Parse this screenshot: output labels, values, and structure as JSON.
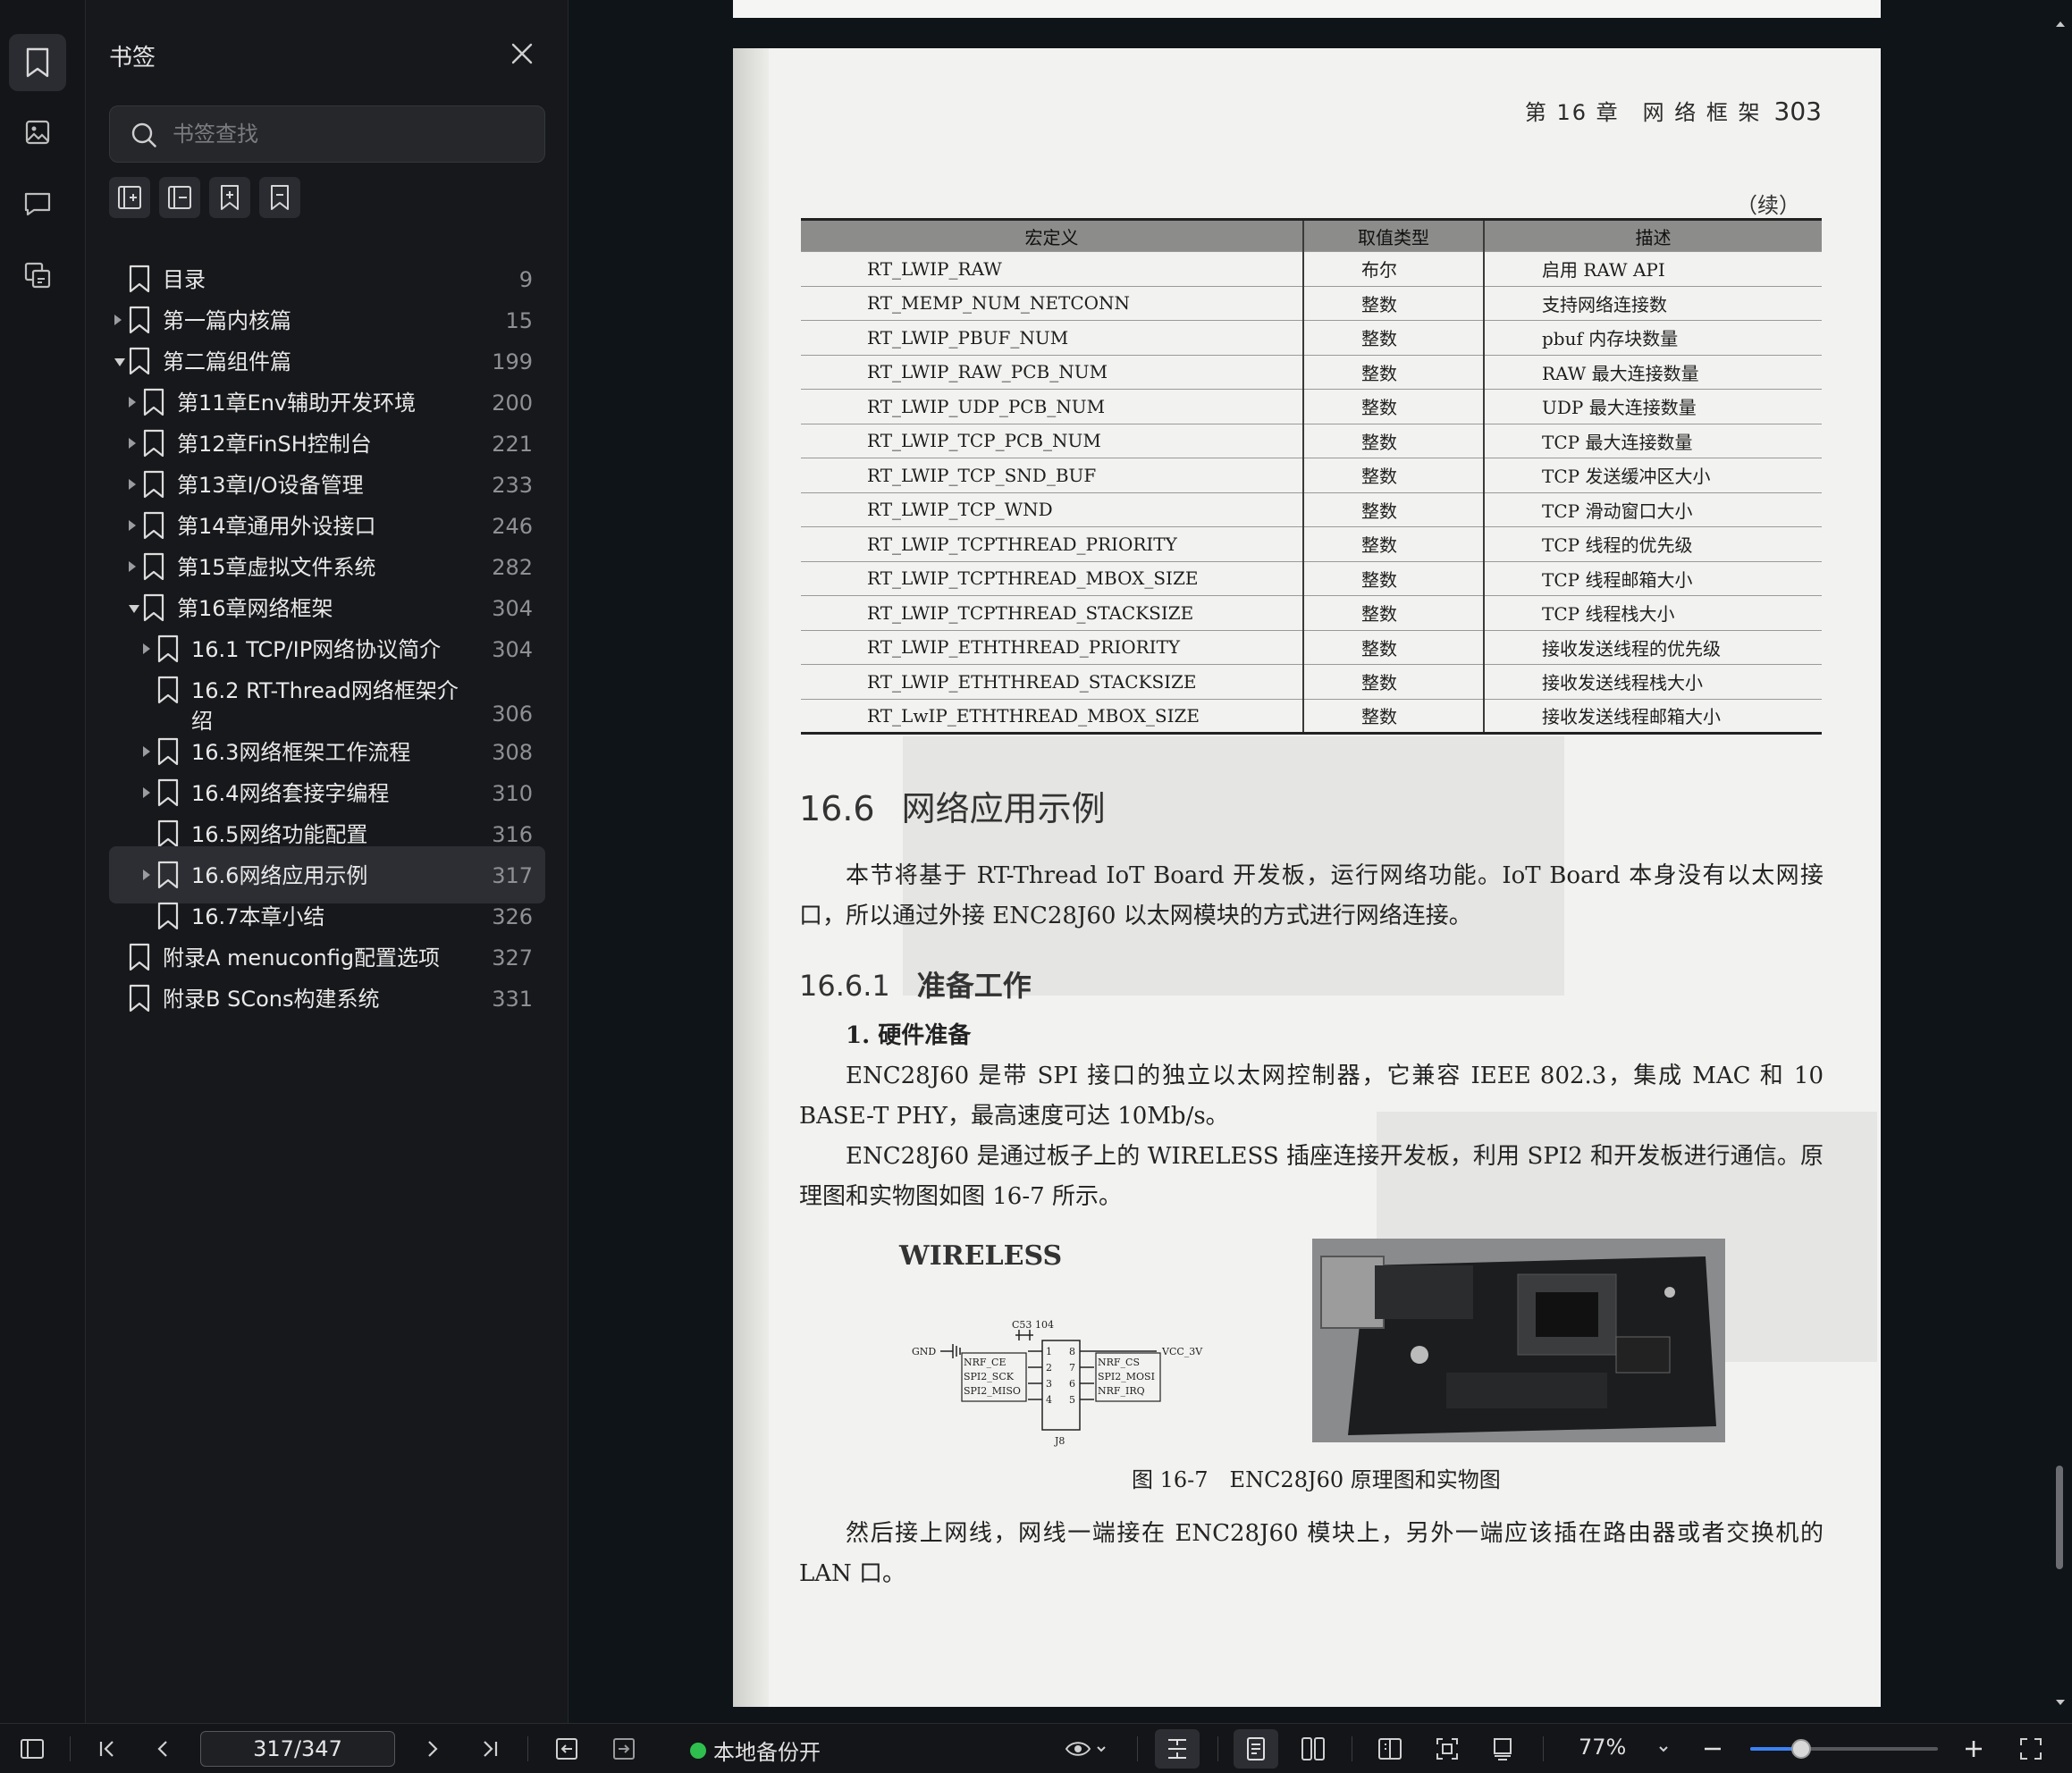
{
  "sidebar": {
    "title": "书签",
    "search_placeholder": "书签查找",
    "items": [
      {
        "label": "目录",
        "page": "9",
        "level": 0,
        "arrow": "none"
      },
      {
        "label": "第一篇内核篇",
        "page": "15",
        "level": 0,
        "arrow": "right"
      },
      {
        "label": "第二篇组件篇",
        "page": "199",
        "level": 0,
        "arrow": "down"
      },
      {
        "label": "第11章Env辅助开发环境",
        "page": "200",
        "level": 1,
        "arrow": "right"
      },
      {
        "label": "第12章FinSH控制台",
        "page": "221",
        "level": 1,
        "arrow": "right"
      },
      {
        "label": "第13章I/O设备管理",
        "page": "233",
        "level": 1,
        "arrow": "right"
      },
      {
        "label": "第14章通用外设接口",
        "page": "246",
        "level": 1,
        "arrow": "right"
      },
      {
        "label": "第15章虚拟文件系统",
        "page": "282",
        "level": 1,
        "arrow": "right"
      },
      {
        "label": "第16章网络框架",
        "page": "304",
        "level": 1,
        "arrow": "down"
      },
      {
        "label": "16.1 TCP/IP网络协议简介",
        "page": "304",
        "level": 2,
        "arrow": "right"
      },
      {
        "label": "16.2 RT-Thread网络框架介",
        "label2": "绍",
        "page": "306",
        "level": 2,
        "arrow": "none"
      },
      {
        "label": "16.3网络框架工作流程",
        "page": "308",
        "level": 2,
        "arrow": "right"
      },
      {
        "label": "16.4网络套接字编程",
        "page": "310",
        "level": 2,
        "arrow": "right"
      },
      {
        "label": "16.5网络功能配置",
        "page": "316",
        "level": 2,
        "arrow": "none"
      },
      {
        "label": "16.6网络应用示例",
        "page": "317",
        "level": 2,
        "arrow": "right",
        "selected": true
      },
      {
        "label": "16.7本章小结",
        "page": "326",
        "level": 2,
        "arrow": "none"
      },
      {
        "label": "附录A menuconfig配置选项",
        "page": "327",
        "level": 0,
        "arrow": "none"
      },
      {
        "label": "附录B SCons构建系统",
        "page": "331",
        "level": 0,
        "arrow": "none"
      }
    ]
  },
  "document": {
    "running_head": "第 16 章　网 络 框 架",
    "page_number": "303",
    "continued": "（续）",
    "table_headers": [
      "宏定义",
      "取值类型",
      "描述"
    ],
    "table_rows": [
      [
        "RT_LWIP_RAW",
        "布尔",
        "启用 RAW API"
      ],
      [
        "RT_MEMP_NUM_NETCONN",
        "整数",
        "支持网络连接数"
      ],
      [
        "RT_LWIP_PBUF_NUM",
        "整数",
        "pbuf 内存块数量"
      ],
      [
        "RT_LWIP_RAW_PCB_NUM",
        "整数",
        "RAW 最大连接数量"
      ],
      [
        "RT_LWIP_UDP_PCB_NUM",
        "整数",
        "UDP 最大连接数量"
      ],
      [
        "RT_LWIP_TCP_PCB_NUM",
        "整数",
        "TCP 最大连接数量"
      ],
      [
        "RT_LWIP_TCP_SND_BUF",
        "整数",
        "TCP 发送缓冲区大小"
      ],
      [
        "RT_LWIP_TCP_WND",
        "整数",
        "TCP 滑动窗口大小"
      ],
      [
        "RT_LWIP_TCPTHREAD_PRIORITY",
        "整数",
        "TCP 线程的优先级"
      ],
      [
        "RT_LWIP_TCPTHREAD_MBOX_SIZE",
        "整数",
        "TCP 线程邮箱大小"
      ],
      [
        "RT_LWIP_TCPTHREAD_STACKSIZE",
        "整数",
        "TCP 线程栈大小"
      ],
      [
        "RT_LWIP_ETHTHREAD_PRIORITY",
        "整数",
        "接收发送线程的优先级"
      ],
      [
        "RT_LWIP_ETHTHREAD_STACKSIZE",
        "整数",
        "接收发送线程栈大小"
      ],
      [
        "RT_LwIP_ETHTHREAD_MBOX_SIZE",
        "整数",
        "接收发送线程邮箱大小"
      ]
    ],
    "section_num": "16.6",
    "section_title": "网络应用示例",
    "para1": "本节将基于 RT-Thread IoT Board 开发板，运行网络功能。IoT Board 本身没有以太网接口，所以通过外接 ENC28J60 以太网模块的方式进行网络连接。",
    "subsection_num": "16.6.1",
    "subsection_title": "准备工作",
    "item_title": "1. 硬件准备",
    "para2": "ENC28J60 是带 SPI 接口的独立以太网控制器，它兼容 IEEE 802.3，集成 MAC 和 10 BASE-T PHY，最高速度可达 10Mb/s。",
    "para3": "ENC28J60 是通过板子上的 WIRELESS 插座连接开发板，利用 SPI2 和开发板进行通信。原理图和实物图如图 16-7 所示。",
    "figure_wireless": "WIRELESS",
    "schematic": {
      "cap": "C53",
      "cap2": "104",
      "gnd": "GND",
      "vcc": "VCC_3V3",
      "left_pins": [
        "NRF_CE",
        "SPI2_SCK",
        "SPI2_MISO"
      ],
      "right_pins": [
        "NRF_CS",
        "SPI2_MOSI",
        "NRF_IRQ"
      ],
      "left_nums": [
        "1",
        "2",
        "3",
        "4"
      ],
      "right_nums": [
        "8",
        "7",
        "6",
        "5"
      ],
      "ref": "J8"
    },
    "figure_caption": "图 16-7　ENC28J60 原理图和实物图",
    "para4": "然后接上网线，网线一端接在 ENC28J60 模块上，另外一端应该插在路由器或者交换机的 LAN 口。"
  },
  "statusbar": {
    "page_indicator": "317/347",
    "backup_label": "本地备份开",
    "zoom_label": "77%",
    "zoom_fraction": 0.27
  }
}
